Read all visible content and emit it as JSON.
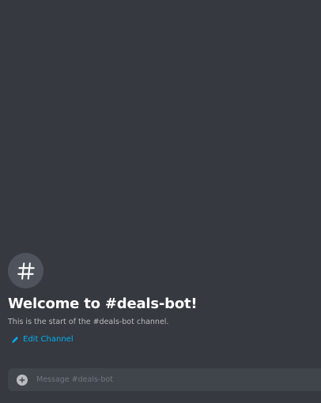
{
  "channel": {
    "icon": "hashtag-icon",
    "welcome_title": "Welcome to #deals-bot!",
    "welcome_subtitle": "This is the start of the #deals-bot channel.",
    "edit_label": "Edit Channel",
    "edit_icon": "pencil-icon"
  },
  "composer": {
    "add_icon": "plus-circle-icon",
    "placeholder": "Message #deals-bot",
    "value": ""
  },
  "colors": {
    "background": "#36393f",
    "icon_circle": "#4f545c",
    "title": "#ffffff",
    "subtitle": "#b9bbbe",
    "link": "#00b0f4",
    "composer_bg": "#40444b",
    "placeholder": "#72767d"
  }
}
